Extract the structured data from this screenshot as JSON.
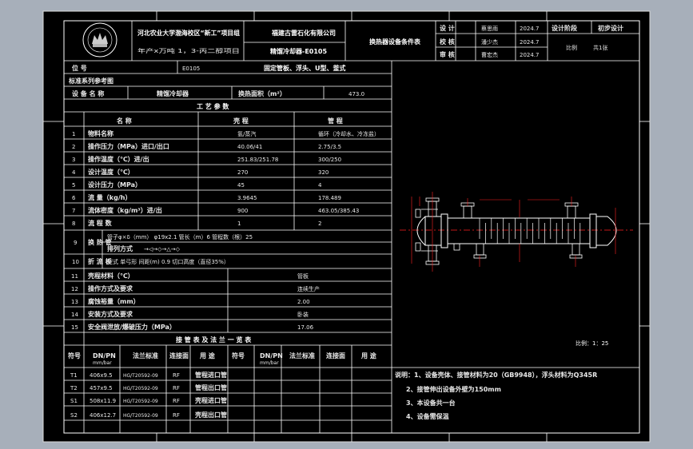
{
  "title_block": {
    "university": "河北农业大学渤海校区“新工”项目组",
    "project": "年产x万吨 1，3-丙二醇项目",
    "company": "福建古雷石化有限公司",
    "equipment_name": "精馏冷却器-E0105",
    "drawing_title": "换热器设备条件表",
    "rows": [
      {
        "role": "设 计",
        "name": "蔡思雨",
        "date": "2024.7"
      },
      {
        "role": "校 核",
        "name": "潘少杰",
        "date": "2024.7"
      },
      {
        "role": "审 核",
        "name": "曹宏杰",
        "date": "2024.7"
      }
    ],
    "stage_label": "设计阶段",
    "stage_value": "初步设计",
    "scale_label": "比例",
    "scale_value": "共1张"
  },
  "header": {
    "tag_label": "位 号",
    "tag_value": "E0105",
    "tag_desc": "固定管板、浮头、U型、釜式",
    "std_label": "标准系列参考图",
    "name_label": "设 备 名 称",
    "name_value": "精馏冷却器",
    "area_label": "换热面积（m²）",
    "area_value": "473.0"
  },
  "process": {
    "heading": "工 艺 参 数",
    "col_item": "名 称",
    "col_shell": "壳 程",
    "col_tube": "管 程",
    "rows": [
      {
        "no": "1",
        "name": "物料名称",
        "shell": "氢/蒸汽",
        "tube": "循环（冷却水、冷冻盐）"
      },
      {
        "no": "2",
        "name": "操作压力（MPa）进口/出口",
        "shell": "40.06/41",
        "tube": "2.75/3.5"
      },
      {
        "no": "3",
        "name": "操作温度（℃）进/出",
        "shell": "251.83/251.78",
        "tube": "300/250"
      },
      {
        "no": "4",
        "name": "设计温度（℃）",
        "shell": "270",
        "tube": "320"
      },
      {
        "no": "5",
        "name": "设计压力（MPa）",
        "shell": "45",
        "tube": "4"
      },
      {
        "no": "6",
        "name": "流 量（kg/h）",
        "shell": "3.9645",
        "tube": "178.489"
      },
      {
        "no": "7",
        "name": "流体密度（kg/m³）进/出",
        "shell": "900",
        "tube": "463.05/385.43"
      },
      {
        "no": "8",
        "name": "流 程 数",
        "shell": "1",
        "tube": "2"
      }
    ],
    "row9_no": "9",
    "row9_name": "换 热 管",
    "row9_spec": "管子φ×δ（mm） φ19x2.1  管长（m）6  管程数（根）25",
    "row9_arr_label": "排列方式",
    "row9_arr_value": "→◁→◇→△→◇",
    "row10_no": "10",
    "row10_name": "折 流 板",
    "row10_value": "型式 单弓形     间距(m) 0.9       切口高度（直径35%）",
    "more": [
      {
        "no": "11",
        "name": "壳程材料（℃）",
        "value": "管板"
      },
      {
        "no": "12",
        "name": "操作方式及要求",
        "value": "连续生产"
      },
      {
        "no": "13",
        "name": "腐蚀裕量（mm）",
        "value": "2.00"
      },
      {
        "no": "14",
        "name": "安装方式及要求",
        "value": "卧装"
      },
      {
        "no": "15",
        "name": "安全阀泄放/爆破压力（MPa）",
        "value": "17.06"
      }
    ]
  },
  "nozzles": {
    "heading": "接 管 表 及 法 兰 一 览 表",
    "cols": [
      "符号",
      "DN/PN",
      "法兰标准",
      "连接面",
      "用 途",
      "符号",
      "DN/PN",
      "法兰标准",
      "连接面",
      "用 途"
    ],
    "col_sub": "mm/bar",
    "rows": [
      {
        "sym": "T1",
        "dn": "406x9.5",
        "std": "HG/T20592-09",
        "face": "RF",
        "use": "管程进口管"
      },
      {
        "sym": "T2",
        "dn": "457x9.5",
        "std": "HG/T20592-09",
        "face": "RF",
        "use": "管程出口管"
      },
      {
        "sym": "S1",
        "dn": "508x11.9",
        "std": "HG/T20592-09",
        "face": "RF",
        "use": "壳程进口管"
      },
      {
        "sym": "S2",
        "dn": "406x12.7",
        "std": "HG/T20592-09",
        "face": "RF",
        "use": "壳程出口管"
      }
    ]
  },
  "notes": {
    "items": [
      "说明：1、设备壳体、接管材料为20（GB9948），浮头材料为Q345R",
      "2、接管伸出设备外壁为150mm",
      "3、本设备共一台",
      "4、设备需保温"
    ],
    "scale": "比例：1：25"
  },
  "colors": {
    "background": "#a7afba",
    "sheet": "#000000",
    "line": "#ffffff",
    "accent": "#ff2020"
  }
}
